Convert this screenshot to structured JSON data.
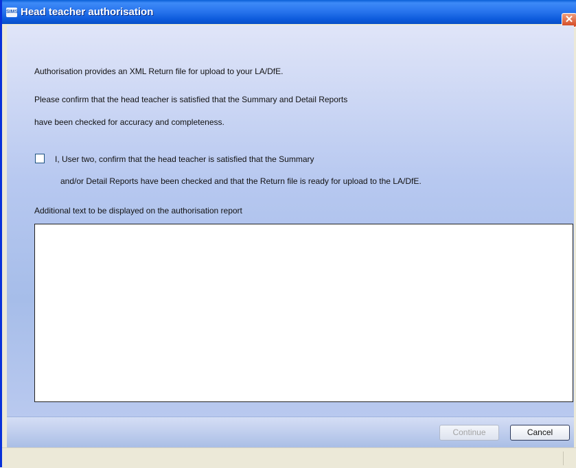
{
  "window": {
    "title": "Head teacher authorisation",
    "app_icon_text": "SIMS",
    "close_glyph": "✕"
  },
  "body": {
    "line1": "Authorisation provides an XML Return file for upload to your LA/DfE.",
    "line2": "Please confirm that the head teacher is satisfied that the Summary and Detail Reports",
    "line3": "have been checked for accuracy and completeness.",
    "checkbox_label_line1": "I, User two, confirm that the head teacher is satisfied that the Summary",
    "checkbox_label_line2": "and/or Detail Reports have been checked and that the Return file is ready for upload to the LA/DfE.",
    "checkbox_checked": false,
    "additional_text_label": "Additional text to be displayed on the authorisation report",
    "additional_text_value": ""
  },
  "buttons": {
    "continue_label": "Continue",
    "continue_enabled": false,
    "cancel_label": "Cancel"
  },
  "icons": {
    "app_icon": "sims-app-icon",
    "close_icon": "close-icon"
  },
  "colors": {
    "titlebar": "#2a76ee",
    "close": "#d3451e",
    "content_bg": "#b7c8f0"
  }
}
